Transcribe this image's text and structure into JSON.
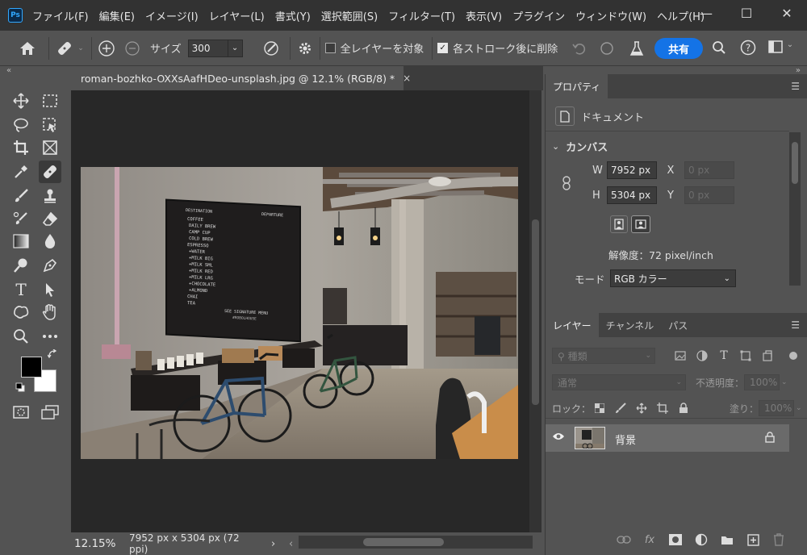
{
  "app": {
    "logo": "Ps",
    "menu": [
      "ファイル(F)",
      "編集(E)",
      "イメージ(I)",
      "レイヤー(L)",
      "書式(Y)",
      "選択範囲(S)",
      "フィルター(T)",
      "表示(V)",
      "プラグイン",
      "ウィンドウ(W)",
      "ヘルプ(H)"
    ],
    "window_controls": {
      "minimize": "—",
      "maximize": "☐",
      "close": "✕"
    }
  },
  "options_bar": {
    "size_label": "サイズ",
    "size_value": "300",
    "all_layers_label": "全レイヤーを対象",
    "all_layers_checked": false,
    "delete_after_stroke_label": "各ストローク後に削除",
    "delete_after_stroke_checked": true,
    "share_label": "共有"
  },
  "document": {
    "tab_title": "roman-bozhko-OXXsAafHDeo-unsplash.jpg @ 12.1% (RGB/8) *",
    "tab_close": "×",
    "zoom": "12.15%",
    "info": "7952 px x 5304 px (72 ppi)",
    "info_arrow": "›",
    "scroll_left_arrow": "‹"
  },
  "photo_board": {
    "header_left": "DESTINATION",
    "header_right": "DEPARTURE",
    "items": [
      "COFFEE",
      "DAILY BREW",
      "CAMP CUP",
      "COLD BREW",
      "ESPRESSO",
      "+WATER",
      "+MILK BIG",
      "+MILK SML",
      "+MILK RED",
      "+MILK LRG",
      "+CHOCOLATE",
      "+ALMOND",
      "CHAI",
      "TEA"
    ],
    "footer": "SEE SIGNATURE MENU",
    "footer2": "#ROBOLHOUSE"
  },
  "properties_panel": {
    "tab": "プロパティ",
    "document_label": "ドキュメント",
    "canvas_header": "カンバス",
    "w_label": "W",
    "w_value": "7952 px",
    "h_label": "H",
    "h_value": "5304 px",
    "x_label": "X",
    "x_value": "0 px",
    "y_label": "Y",
    "y_value": "0 px",
    "resolution": "解像度：72 pixel/inch",
    "mode_label": "モード",
    "mode_value": "RGB カラー"
  },
  "layers_panel": {
    "tabs": [
      "レイヤー",
      "チャンネル",
      "パス"
    ],
    "filter_placeholder": "種類",
    "blend_mode": "通常",
    "opacity_label": "不透明度：",
    "opacity_value": "100%",
    "lock_label": "ロック：",
    "fill_label": "塗り：",
    "fill_value": "100%",
    "layer_name": "背景"
  }
}
